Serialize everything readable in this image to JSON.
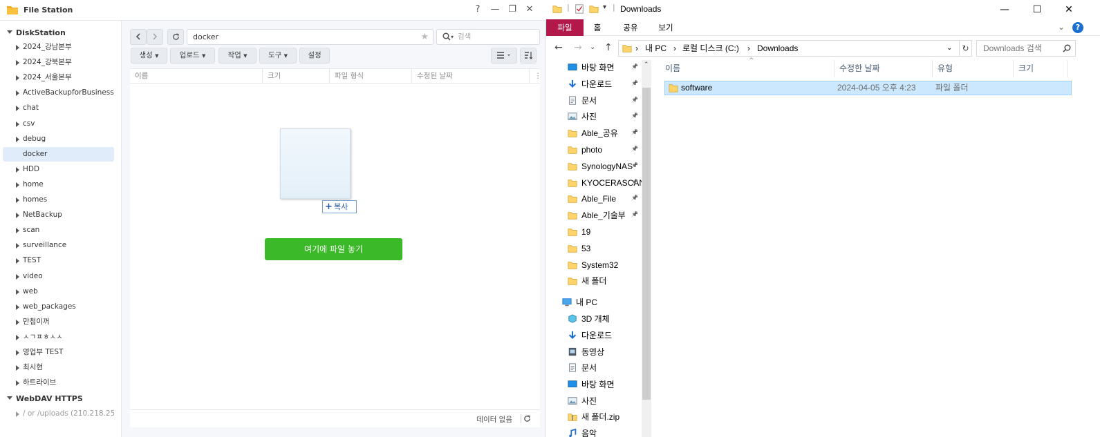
{
  "filestation": {
    "title": "File Station",
    "window_buttons": [
      "?",
      "—",
      "❐",
      "✕"
    ],
    "tree": {
      "root": "DiskStation",
      "items": [
        "2024_강남본부",
        "2024_강북본부",
        "2024_서울본부",
        "ActiveBackupforBusiness",
        "chat",
        "csv",
        "debug",
        "docker",
        "HDD",
        "home",
        "homes",
        "NetBackup",
        "scan",
        "surveillance",
        "TEST",
        "video",
        "web",
        "web_packages",
        "만첩이꺼",
        "ㅅㄱㅍㅎㅅㅅ",
        "영업부 TEST",
        "최시현",
        "하트라이브"
      ],
      "selected": "docker",
      "root2": "WebDAV HTTPS",
      "sub_item": "/ or /uploads (210.218.25"
    },
    "path": "docker",
    "search_placeholder": "검색",
    "toolbar": {
      "create": "생성",
      "upload": "업로드",
      "action": "작업",
      "tools": "도구",
      "settings": "설정"
    },
    "columns": [
      "이름",
      "크기",
      "파일 형식",
      "수정된 날짜"
    ],
    "copy_tip": "복사",
    "drop_label": "여기에 파일 놓기",
    "status": "데이터 없음"
  },
  "explorer": {
    "title": "Downloads",
    "window_buttons": [
      "—",
      "☐",
      "✕"
    ],
    "ribbon_tabs": [
      "파일",
      "홈",
      "공유",
      "보기"
    ],
    "breadcrumb": [
      "내 PC",
      "로컬 디스크 (C:)",
      "Downloads"
    ],
    "search_placeholder": "Downloads 검색",
    "quick_access": [
      "바탕 화면",
      "다운로드",
      "문서",
      "사진",
      "Able_공유",
      "photo",
      "SynologyNAS",
      "KYOCERASCAN",
      "Able_File",
      "Able_기술부",
      "19",
      "53",
      "System32",
      "새 폴더"
    ],
    "this_pc_label": "내 PC",
    "this_pc_items": [
      "3D 개체",
      "다운로드",
      "동영상",
      "문서",
      "바탕 화면",
      "사진",
      "새 폴더.zip",
      "음악"
    ],
    "columns": [
      "이름",
      "수정한 날짜",
      "유형",
      "크기"
    ],
    "files": [
      {
        "name": "software",
        "modified": "2024-04-05 오후 4:23",
        "type": "파일 폴더",
        "size": ""
      }
    ]
  }
}
